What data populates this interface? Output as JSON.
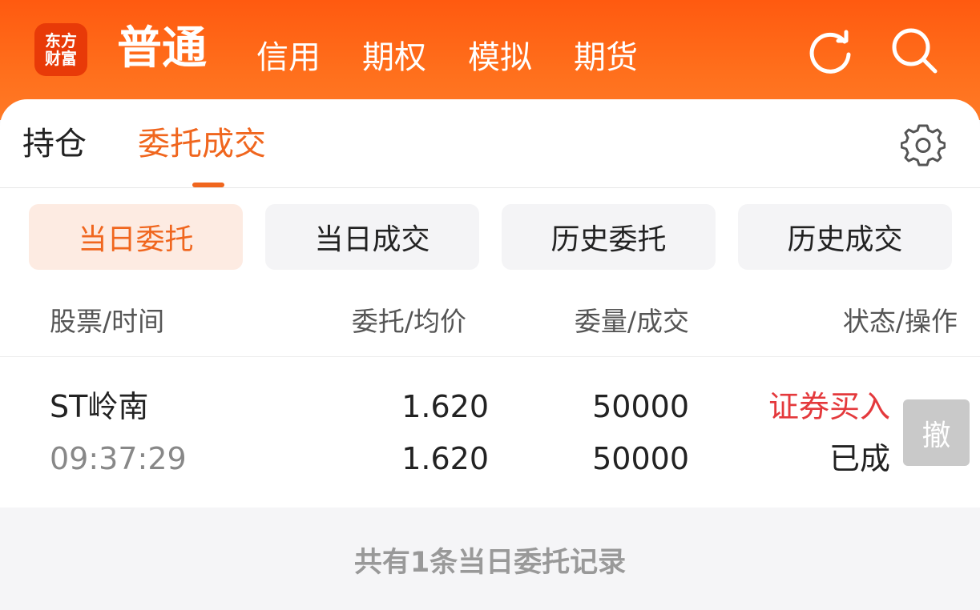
{
  "header": {
    "logo_line1": "东方",
    "logo_line2": "财富",
    "nav_main": "普通",
    "nav_items": [
      "信用",
      "期权",
      "模拟",
      "期货"
    ],
    "refresh_icon": "refresh-icon",
    "search_icon": "search-icon",
    "brand_color": "#ff5a10"
  },
  "tabs": {
    "items": [
      "持仓",
      "委托成交"
    ],
    "active": "委托成交",
    "settings_icon": "gear-icon",
    "accent": "#f0661e"
  },
  "segments": {
    "items": [
      "当日委托",
      "当日成交",
      "历史委托",
      "历史成交"
    ],
    "active": "当日委托"
  },
  "table": {
    "headers": [
      "股票/时间",
      "委托/均价",
      "委量/成交",
      "状态/操作"
    ],
    "rows": [
      {
        "stock": "ST岭南",
        "time": "09:37:29",
        "order_price": "1.620",
        "avg_price": "1.620",
        "order_qty": "50000",
        "filled_qty": "50000",
        "direction": "证券买入",
        "status": "已成",
        "action_label": "撤"
      }
    ]
  },
  "footer": {
    "summary": "共有1条当日委托记录"
  }
}
